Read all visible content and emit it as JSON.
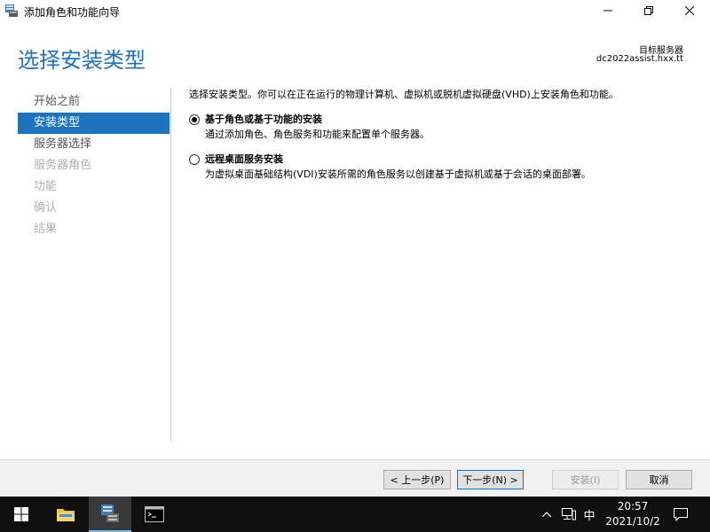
{
  "window": {
    "title": "添加角色和功能向导",
    "page_title": "选择安装类型",
    "target_label": "目标服务器",
    "target_server": "dc2022assist.hxx.tt"
  },
  "nav": [
    {
      "label": "开始之前",
      "state": "done"
    },
    {
      "label": "安装类型",
      "state": "active"
    },
    {
      "label": "服务器选择",
      "state": "done"
    },
    {
      "label": "服务器角色",
      "state": "pending"
    },
    {
      "label": "功能",
      "state": "pending"
    },
    {
      "label": "确认",
      "state": "pending"
    },
    {
      "label": "结果",
      "state": "pending"
    }
  ],
  "content": {
    "intro": "选择安装类型。你可以在正在运行的物理计算机、虚拟机或脱机虚拟硬盘(VHD)上安装角色和功能。",
    "options": [
      {
        "title": "基于角色或基于功能的安装",
        "desc": "通过添加角色、角色服务和功能来配置单个服务器。",
        "checked": true
      },
      {
        "title": "远程桌面服务安装",
        "desc": "为虚拟桌面基础结构(VDI)安装所需的角色服务以创建基于虚拟机或基于会话的桌面部署。",
        "checked": false
      }
    ]
  },
  "footer": {
    "prev": "< 上一步(P)",
    "next": "下一步(N) >",
    "install": "安装(I)",
    "cancel": "取消"
  },
  "taskbar": {
    "ime": "中",
    "time": "20:57",
    "date": "2021/10/2"
  },
  "colors": {
    "accent": "#1e73be",
    "taskbar": "#101010"
  }
}
